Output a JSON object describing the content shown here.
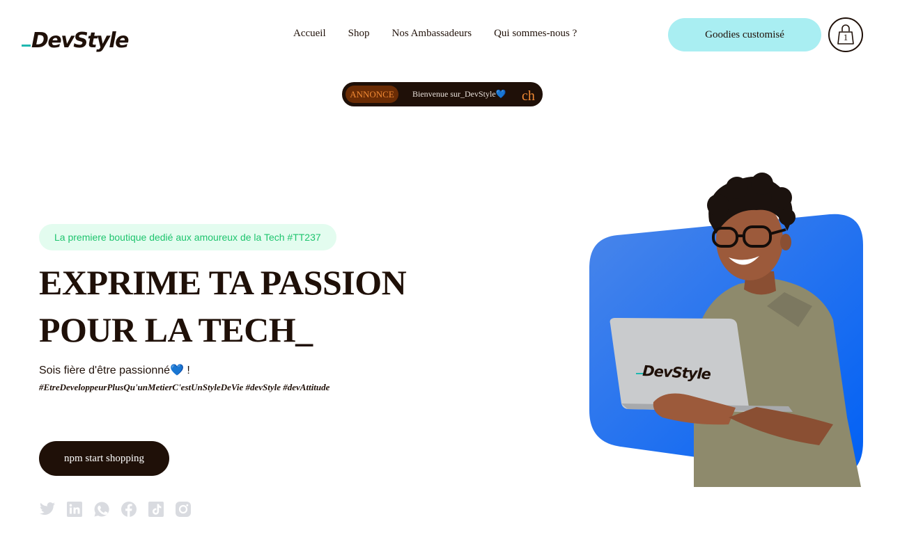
{
  "header": {
    "logo": "DevStyle",
    "nav": [
      "Accueil",
      "Shop",
      "Nos Ambassadeurs",
      "Qui sommes-nous ?"
    ],
    "cta_label": "Goodies customisé",
    "cart_count": "1"
  },
  "announcement": {
    "badge": "ANNONCE",
    "text": "Bienvenue sur_DevStyle",
    "next_text": "ch"
  },
  "hero": {
    "tagline": "La premiere boutique dedié aux amoureux de la Tech #TT237",
    "title_line1": "EXPRIME TA PASSION",
    "title_line2": "POUR LA TECH_",
    "subtitle": "Sois fière d'être passionné",
    "subtitle_end": " !",
    "hashtags": "#EtreDeveloppeurPlusQu'unMetierC'estUnStyleDeVie #devStyle #devAttitude",
    "button_label": "npm start shopping",
    "laptop_logo": "DevStyle"
  },
  "socials": [
    "twitter-icon",
    "linkedin-icon",
    "whatsapp-icon",
    "facebook-icon",
    "tiktok-icon",
    "instagram-icon"
  ],
  "colors": {
    "dark": "#1f1008",
    "accent_cyan": "#a9eef2",
    "tagline_bg": "#e3fcef",
    "tagline_text": "#1ec46e",
    "announce_orange": "#f28a34",
    "hero_blue": "#1a6cf0",
    "social_gray": "#d9dbe0"
  }
}
